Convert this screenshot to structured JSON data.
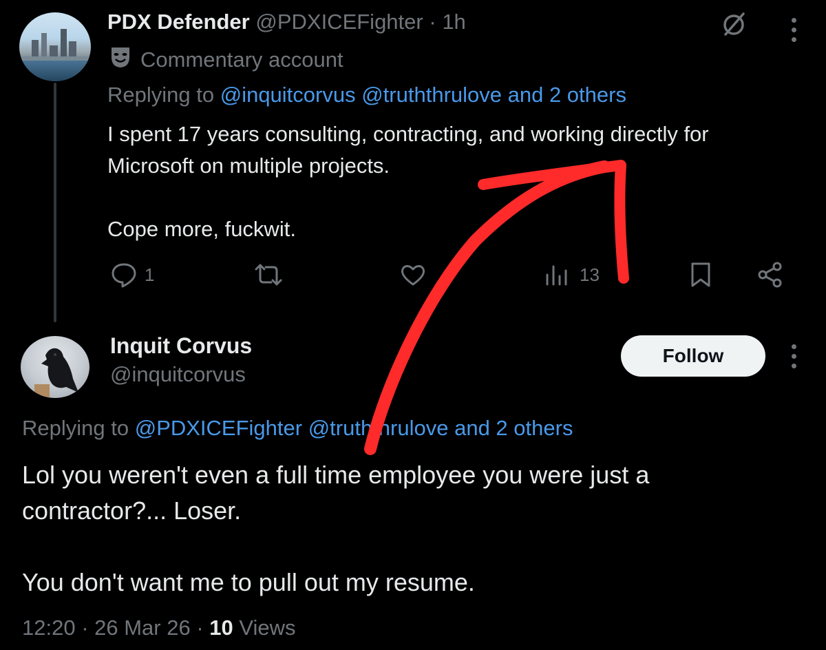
{
  "tweet1": {
    "display_name": "PDX Defender",
    "handle": "@PDXICEFighter",
    "separator": "·",
    "time": "1h",
    "label_icon": "theater-masks-icon",
    "label": "Commentary account",
    "replying_prefix": "Replying to",
    "replying_targets": "@inquitcorvus @truththrulove and 2 others",
    "body_line1": "I spent 17 years consulting, contracting, and working directly for",
    "body_line2": "Microsoft on multiple projects.",
    "body_line3": "Cope more, fuckwit.",
    "actions": {
      "reply_count": "1",
      "views_count": "13"
    }
  },
  "tweet2": {
    "display_name": "Inquit Corvus",
    "handle": "@inquitcorvus",
    "follow_label": "Follow",
    "replying_prefix": "Replying to",
    "replying_targets": "@PDXICEFighter @truththrulove and 2 others",
    "body_line1": "Lol you weren't even a full time employee you were just a",
    "body_line2": "contractor?... Loser.",
    "body_line3": "You don't want me to pull out my resume.",
    "timestamp": "12:20 · 26 Mar 26 ·",
    "views_count": "10",
    "views_label": "Views"
  },
  "colors": {
    "background": "#000000",
    "text": "#e7e9ea",
    "muted": "#71767b",
    "link": "#4a99e9",
    "annotation_arrow": "#ff2a2a"
  }
}
